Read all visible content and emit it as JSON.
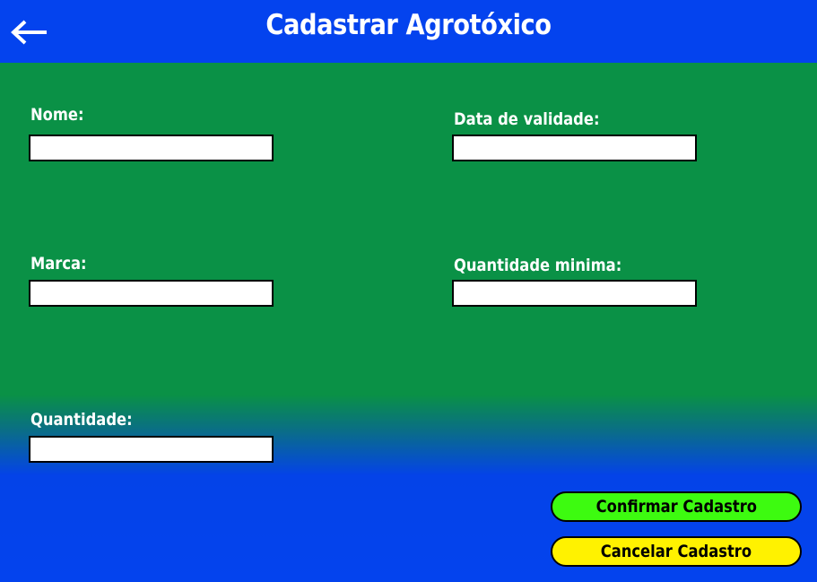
{
  "header": {
    "title": "Cadastrar Agrotóxico",
    "back_icon": "arrow-left-icon"
  },
  "form": {
    "nome": {
      "label": "Nome:",
      "value": ""
    },
    "data_validade": {
      "label": "Data de validade:",
      "value": ""
    },
    "marca": {
      "label": "Marca:",
      "value": ""
    },
    "quantidade_minima": {
      "label": "Quantidade minima:",
      "value": ""
    },
    "quantidade": {
      "label": "Quantidade:",
      "value": ""
    }
  },
  "actions": {
    "confirm_label": "Confirmar Cadastro",
    "cancel_label": "Cancelar Cadastro"
  },
  "colors": {
    "header_bg": "#0443ee",
    "form_bg": "#0a9146",
    "confirm_bg": "#3dfb10",
    "cancel_bg": "#fff200"
  }
}
